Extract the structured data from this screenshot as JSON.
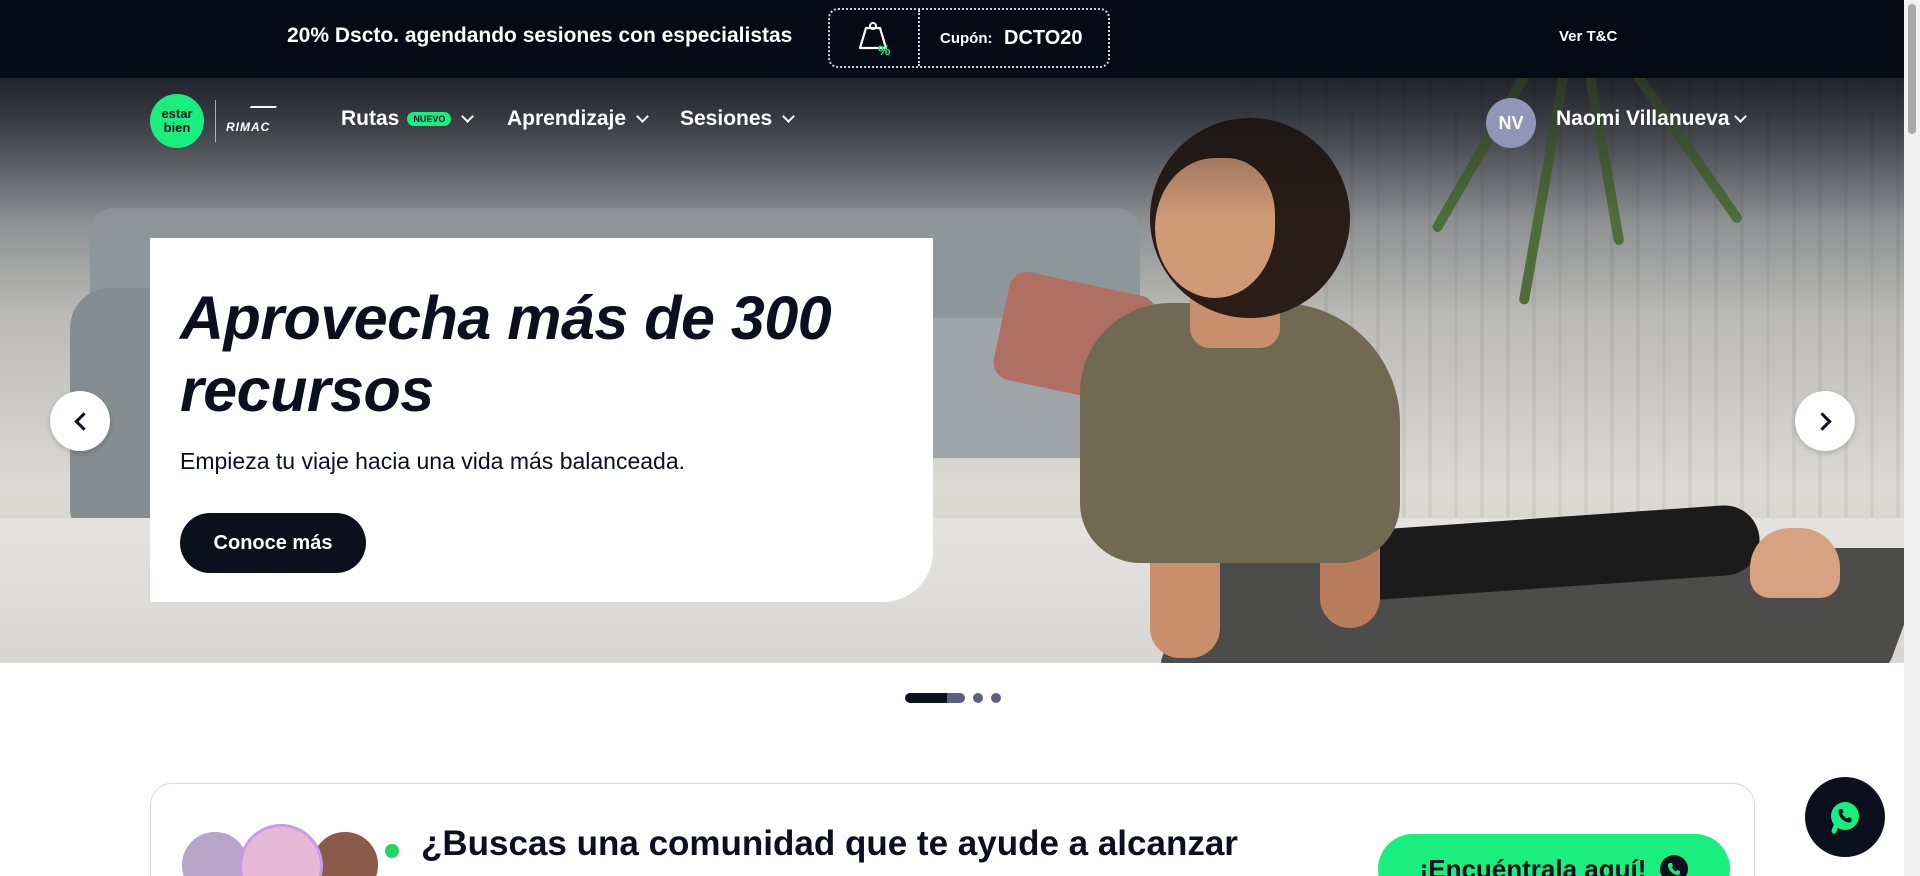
{
  "promo": {
    "text": "20% Dscto. agendando sesiones con especialistas",
    "coupon_label": "Cupón:",
    "coupon_code": "DCTO20",
    "terms_link": "Ver T&C"
  },
  "nav": {
    "logo_line1": "estar",
    "logo_line2": "bien",
    "partner": "RIMAC",
    "items": [
      {
        "label": "Rutas",
        "badge": "NUEVO"
      },
      {
        "label": "Aprendizaje"
      },
      {
        "label": "Sesiones"
      }
    ],
    "user": {
      "initials": "NV",
      "name": "Naomi Villanueva"
    }
  },
  "hero": {
    "title": "Aprovecha más de 300 recursos",
    "subtitle": "Empieza tu viaje hacia una vida más balanceada.",
    "cta": "Conoce más",
    "slides": 3,
    "active_slide": 1
  },
  "community": {
    "title": "¿Buscas una comunidad que te ayude a alcanzar",
    "cta": "¡Encuéntrala aquí!"
  },
  "colors": {
    "brand_green": "#1aee7e",
    "dark_navy": "#0b0f1e",
    "avatar_bg": "#8f96b8"
  }
}
